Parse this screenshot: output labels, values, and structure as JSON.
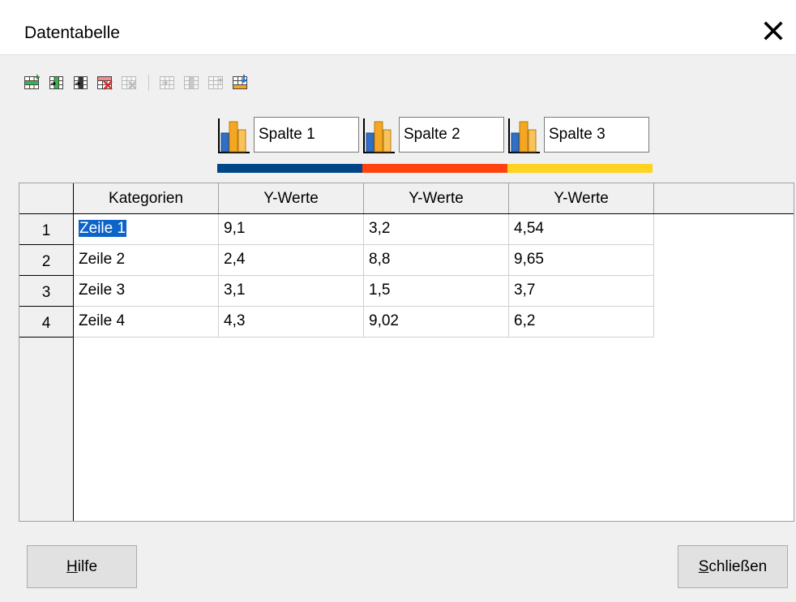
{
  "window": {
    "title": "Datentabelle"
  },
  "toolbar": {
    "buttons": [
      {
        "name": "insert-row-button",
        "icon": "insert-row-icon",
        "enabled": true
      },
      {
        "name": "insert-series-button",
        "icon": "insert-series-icon",
        "enabled": true
      },
      {
        "name": "insert-text-column-button",
        "icon": "insert-text-column-icon",
        "enabled": true
      },
      {
        "name": "delete-row-button",
        "icon": "delete-row-icon",
        "enabled": true
      },
      {
        "name": "delete-series-button",
        "icon": "delete-series-icon",
        "enabled": false
      },
      {
        "name": "move-up-button",
        "icon": "move-up-icon",
        "enabled": false
      },
      {
        "name": "move-down-button",
        "icon": "move-down-icon",
        "enabled": false
      },
      {
        "name": "move-left-button",
        "icon": "move-left-icon",
        "enabled": false
      },
      {
        "name": "move-right-button",
        "icon": "move-right-icon",
        "enabled": true
      }
    ]
  },
  "series": [
    {
      "name": "Spalte 1",
      "color": "#004586"
    },
    {
      "name": "Spalte 2",
      "color": "#ff420e"
    },
    {
      "name": "Spalte 3",
      "color": "#ffd320"
    }
  ],
  "table": {
    "headers": [
      "Kategorien",
      "Y-Werte",
      "Y-Werte",
      "Y-Werte"
    ],
    "rows": [
      {
        "num": "1",
        "cells": [
          "Zeile 1",
          "9,1",
          "3,2",
          "4,54"
        ]
      },
      {
        "num": "2",
        "cells": [
          "Zeile 2",
          "2,4",
          "8,8",
          "9,65"
        ]
      },
      {
        "num": "3",
        "cells": [
          "Zeile 3",
          "3,1",
          "1,5",
          "3,7"
        ]
      },
      {
        "num": "4",
        "cells": [
          "Zeile 4",
          "4,3",
          "9,02",
          "6,2"
        ]
      }
    ],
    "selected_cell": "Zeile 1"
  },
  "buttons": {
    "help_accel": "H",
    "help_rest": "ilfe",
    "close_accel": "S",
    "close_rest": "chließen"
  }
}
